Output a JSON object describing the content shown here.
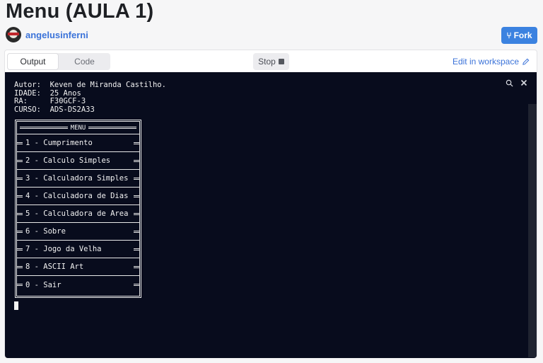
{
  "page": {
    "title": "Menu (AULA 1)"
  },
  "author": {
    "name": "angelusinferni",
    "avatar_icon": "avatar-image"
  },
  "fork": {
    "label": "Fork",
    "icon": "fork-icon"
  },
  "tabs": [
    {
      "label": "Output",
      "active": true
    },
    {
      "label": "Code",
      "active": false
    }
  ],
  "stop": {
    "label": "Stop"
  },
  "edit": {
    "label": "Edit in workspace",
    "icon": "pencil-icon"
  },
  "console": {
    "header_lines": [
      "Autor:  Keven de Miranda Castilho.",
      "IDADE:  25 Anos",
      "RA:     F30GCF-3",
      "CURSO:  ADS-DS2A33"
    ],
    "menu_title": "MENU",
    "menu_items": [
      "1 - Cumprimento",
      "2 - Calculo Simples",
      "3 - Calculadora Simples",
      "4 - Calculadora de Dias",
      "5 - Calculadora de Area",
      "6 - Sobre",
      "7 - Jogo da Velha",
      "8 - ASCII Art",
      "0 - Sair"
    ]
  }
}
